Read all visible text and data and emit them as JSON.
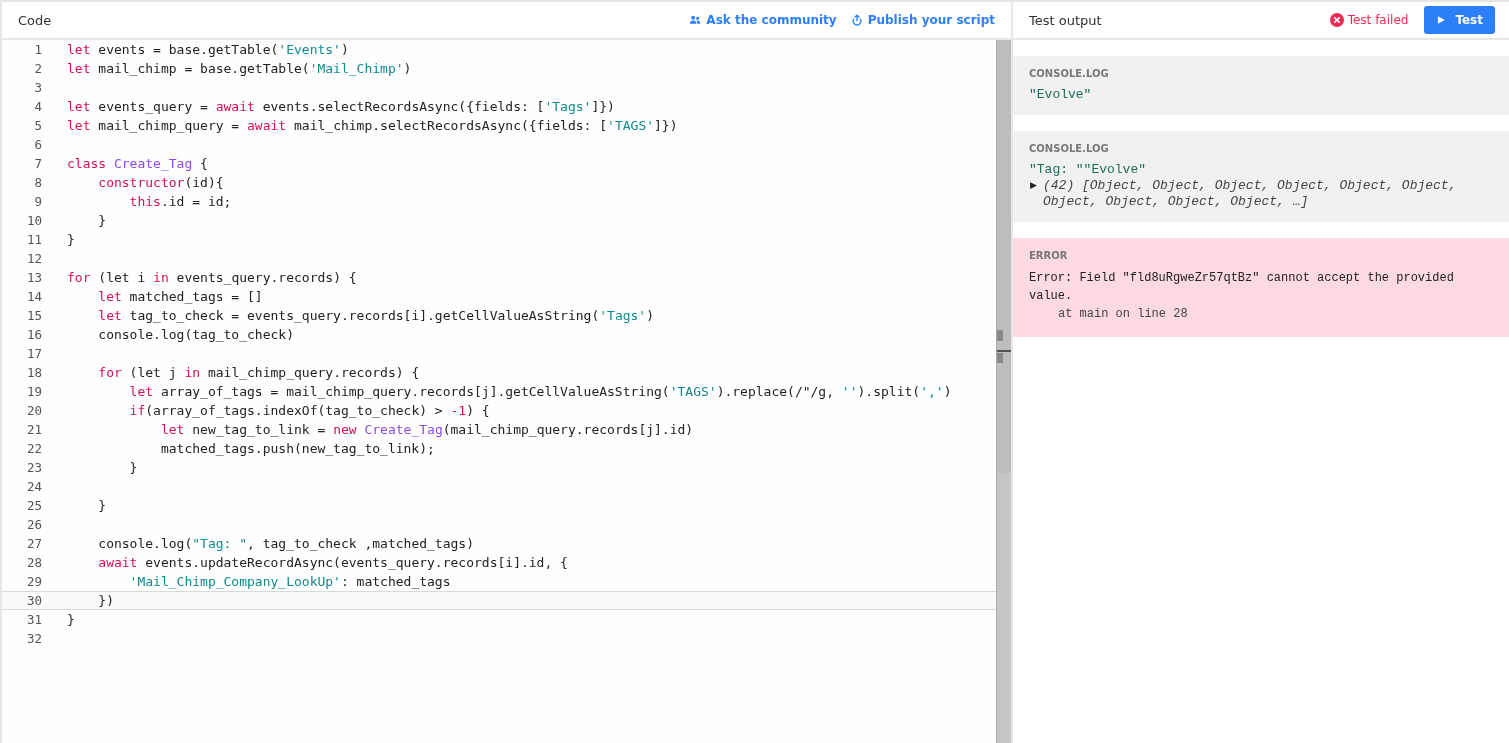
{
  "code_panel": {
    "title": "Code",
    "links": [
      {
        "label": "Ask the community",
        "kind": "community"
      },
      {
        "label": "Publish your script",
        "kind": "publish"
      }
    ],
    "lines": [
      {
        "number": "1",
        "current": false,
        "tokens": [
          {
            "kind": "keyword",
            "text": "let"
          },
          {
            "kind": "plain",
            "text": " events = base.getTable("
          },
          {
            "kind": "string",
            "text": "'Events'"
          },
          {
            "kind": "plain",
            "text": ")"
          }
        ]
      },
      {
        "number": "2",
        "current": false,
        "tokens": [
          {
            "kind": "keyword",
            "text": "let"
          },
          {
            "kind": "plain",
            "text": " mail_chimp = base.getTable("
          },
          {
            "kind": "string",
            "text": "'Mail_Chimp'"
          },
          {
            "kind": "plain",
            "text": ")"
          }
        ]
      },
      {
        "number": "3",
        "current": false
      },
      {
        "number": "4",
        "current": false,
        "tokens": [
          {
            "kind": "keyword",
            "text": "let"
          },
          {
            "kind": "plain",
            "text": " events_query = "
          },
          {
            "kind": "keyword",
            "text": "await"
          },
          {
            "kind": "plain",
            "text": " events.selectRecordsAsync({fields: ["
          },
          {
            "kind": "string",
            "text": "'Tags'"
          },
          {
            "kind": "plain",
            "text": "]})"
          }
        ]
      },
      {
        "number": "5",
        "current": false,
        "tokens": [
          {
            "kind": "keyword",
            "text": "let"
          },
          {
            "kind": "plain",
            "text": " mail_chimp_query = "
          },
          {
            "kind": "keyword",
            "text": "await"
          },
          {
            "kind": "plain",
            "text": " mail_chimp.selectRecordsAsync({fields: ["
          },
          {
            "kind": "string",
            "text": "'TAGS'"
          },
          {
            "kind": "plain",
            "text": "]})"
          }
        ]
      },
      {
        "number": "6",
        "current": false
      },
      {
        "number": "7",
        "current": false,
        "tokens": [
          {
            "kind": "keyword",
            "text": "class "
          },
          {
            "kind": "classname",
            "text": "Create_Tag"
          },
          {
            "kind": "plain",
            "text": " {"
          }
        ]
      },
      {
        "number": "8",
        "current": false,
        "tokens": [
          {
            "kind": "keyword",
            "text": "    constructor"
          },
          {
            "kind": "plain",
            "text": "(id){"
          }
        ]
      },
      {
        "number": "9",
        "current": false,
        "tokens": [
          {
            "kind": "keyword",
            "text": "        this"
          },
          {
            "kind": "plain",
            "text": ".id = id;"
          }
        ]
      },
      {
        "number": "10",
        "current": false,
        "tokens": [
          {
            "kind": "plain",
            "text": "    }"
          }
        ]
      },
      {
        "number": "11",
        "current": false,
        "tokens": [
          {
            "kind": "plain",
            "text": "}"
          }
        ]
      },
      {
        "number": "12",
        "current": false
      },
      {
        "number": "13",
        "current": false,
        "tokens": [
          {
            "kind": "keyword",
            "text": "for"
          },
          {
            "kind": "plain",
            "text": " (let i "
          },
          {
            "kind": "keyword",
            "text": "in"
          },
          {
            "kind": "plain",
            "text": " events_query.records) {"
          }
        ]
      },
      {
        "number": "14",
        "current": false,
        "tokens": [
          {
            "kind": "keyword",
            "text": "    let"
          },
          {
            "kind": "plain",
            "text": " matched_tags = []"
          }
        ]
      },
      {
        "number": "15",
        "current": false,
        "tokens": [
          {
            "kind": "keyword",
            "text": "    let"
          },
          {
            "kind": "plain",
            "text": " tag_to_check = events_query.records[i].getCellValueAsString("
          },
          {
            "kind": "string",
            "text": "'Tags'"
          },
          {
            "kind": "plain",
            "text": ")"
          }
        ]
      },
      {
        "number": "16",
        "current": false,
        "tokens": [
          {
            "kind": "plain",
            "text": "    console.log(tag_to_check)"
          }
        ]
      },
      {
        "number": "17",
        "current": false
      },
      {
        "number": "18",
        "current": false,
        "tokens": [
          {
            "kind": "keyword",
            "text": "    for"
          },
          {
            "kind": "plain",
            "text": " (let j "
          },
          {
            "kind": "keyword",
            "text": "in"
          },
          {
            "kind": "plain",
            "text": " mail_chimp_query.records) {"
          }
        ]
      },
      {
        "number": "19",
        "current": false,
        "tokens": [
          {
            "kind": "keyword",
            "text": "        let"
          },
          {
            "kind": "plain",
            "text": " array_of_tags = mail_chimp_query.records[j].getCellValueAsString("
          },
          {
            "kind": "string",
            "text": "'TAGS'"
          },
          {
            "kind": "plain",
            "text": ").replace(/\"/g, "
          },
          {
            "kind": "string",
            "text": "''"
          },
          {
            "kind": "plain",
            "text": ").split("
          },
          {
            "kind": "string",
            "text": "','"
          },
          {
            "kind": "plain",
            "text": ")"
          }
        ]
      },
      {
        "number": "20",
        "current": false,
        "tokens": [
          {
            "kind": "keyword",
            "text": "        if"
          },
          {
            "kind": "plain",
            "text": "(array_of_tags.indexOf(tag_to_check) > "
          },
          {
            "kind": "number",
            "text": "-1"
          },
          {
            "kind": "plain",
            "text": ") {"
          }
        ]
      },
      {
        "number": "21",
        "current": false,
        "tokens": [
          {
            "kind": "keyword",
            "text": "            let"
          },
          {
            "kind": "plain",
            "text": " new_tag_to_link = "
          },
          {
            "kind": "keyword",
            "text": "new "
          },
          {
            "kind": "classname",
            "text": "Create_Tag"
          },
          {
            "kind": "plain",
            "text": "(mail_chimp_query.records[j].id)"
          }
        ]
      },
      {
        "number": "22",
        "current": false,
        "tokens": [
          {
            "kind": "plain",
            "text": "            matched_tags.push(new_tag_to_link);"
          }
        ]
      },
      {
        "number": "23",
        "current": false,
        "tokens": [
          {
            "kind": "plain",
            "text": "        }"
          }
        ]
      },
      {
        "number": "24",
        "current": false
      },
      {
        "number": "25",
        "current": false,
        "tokens": [
          {
            "kind": "plain",
            "text": "    }"
          }
        ]
      },
      {
        "number": "26",
        "current": false
      },
      {
        "number": "27",
        "current": false,
        "tokens": [
          {
            "kind": "plain",
            "text": "    console.log("
          },
          {
            "kind": "string",
            "text": "\"Tag: \""
          },
          {
            "kind": "plain",
            "text": ", tag_to_check ,matched_tags)"
          }
        ]
      },
      {
        "number": "28",
        "current": false,
        "tokens": [
          {
            "kind": "keyword",
            "text": "    await"
          },
          {
            "kind": "plain",
            "text": " events.updateRecordAsync(events_query.records[i].id, {"
          }
        ]
      },
      {
        "number": "29",
        "current": false,
        "tokens": [
          {
            "kind": "string",
            "text": "        'Mail_Chimp_Company_LookUp'"
          },
          {
            "kind": "plain",
            "text": ": matched_tags"
          }
        ]
      },
      {
        "number": "30",
        "current": true,
        "tokens": [
          {
            "kind": "plain",
            "text": "    })"
          }
        ]
      },
      {
        "number": "31",
        "current": false,
        "tokens": [
          {
            "kind": "plain",
            "text": "}"
          }
        ]
      },
      {
        "number": "32",
        "current": false
      }
    ]
  },
  "output_panel": {
    "title": "Test output",
    "status": {
      "label": "Test failed",
      "kind": "failed"
    },
    "run_button": {
      "label": "Test"
    },
    "entries": [
      {
        "kind": "log",
        "label": "CONSOLE.LOG",
        "lines": [
          {
            "kind": "string",
            "text": "\"Evolve\""
          }
        ]
      },
      {
        "kind": "log",
        "label": "CONSOLE.LOG",
        "lines": [
          {
            "kind": "string",
            "text": "\"Tag: \"\"Evolve\""
          },
          {
            "kind": "array",
            "text": "(42) [Object, Object, Object, Object, Object, Object, Object, Object, Object, Object, …]"
          }
        ]
      },
      {
        "kind": "error",
        "label": "ERROR",
        "lines": [
          {
            "kind": "message",
            "text": "Error: Field \"fld8uRgweZr57qtBz\" cannot accept the provided value."
          },
          {
            "kind": "trace",
            "text": "at main on line 28"
          }
        ]
      }
    ]
  }
}
